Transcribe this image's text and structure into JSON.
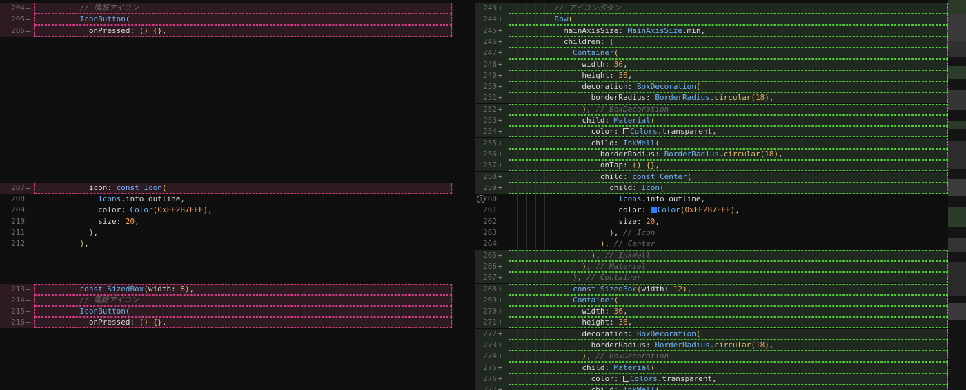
{
  "colors": {
    "removed_bg": "#2e1b21",
    "removed_border": "#d33a86",
    "added_bg": "#20291f",
    "added_border": "#4ed02c",
    "swatch_blue": "#2B7FFF"
  },
  "left_pane": {
    "lines": [
      {
        "num": "204",
        "mark": "—",
        "type": "del",
        "tokens": [
          [
            "cm",
            "// 情報アイコン"
          ]
        ]
      },
      {
        "num": "205",
        "mark": "—",
        "type": "del",
        "tokens": [
          [
            "t",
            "IconButton"
          ],
          [
            "f",
            "("
          ]
        ]
      },
      {
        "num": "206",
        "mark": "—",
        "type": "del",
        "tokens": [
          [
            "p",
            "  onPressed: "
          ],
          [
            "f",
            "() {}"
          ],
          [
            "p",
            ","
          ]
        ]
      },
      {
        "gap": 13
      },
      {
        "num": "207",
        "mark": "—",
        "type": "del",
        "tokens": [
          [
            "p",
            "  icon: "
          ],
          [
            "k",
            "const "
          ],
          [
            "t",
            "Icon"
          ],
          [
            "f",
            "("
          ]
        ]
      },
      {
        "num": "208",
        "tokens": [
          [
            "p",
            "    "
          ],
          [
            "t",
            "Icons"
          ],
          [
            "p",
            ".info_outline,"
          ]
        ]
      },
      {
        "num": "209",
        "tokens": [
          [
            "p",
            "    color: "
          ],
          [
            "t",
            "Color"
          ],
          [
            "f",
            "("
          ],
          [
            "n",
            "0xFF2B7FFF"
          ],
          [
            "f",
            ")"
          ],
          [
            "p",
            ","
          ]
        ]
      },
      {
        "num": "210",
        "tokens": [
          [
            "p",
            "    size: "
          ],
          [
            "n",
            "20"
          ],
          [
            "p",
            ","
          ]
        ]
      },
      {
        "num": "211",
        "tokens": [
          [
            "f",
            "  )"
          ],
          [
            "p",
            ","
          ]
        ]
      },
      {
        "num": "212",
        "tokens": [
          [
            "f",
            ")"
          ],
          [
            "p",
            ","
          ]
        ]
      },
      {
        "gap": 3
      },
      {
        "num": "213",
        "mark": "—",
        "type": "del",
        "tokens": [
          [
            "k",
            "const "
          ],
          [
            "t",
            "SizedBox"
          ],
          [
            "f",
            "("
          ],
          [
            "p",
            "width: "
          ],
          [
            "n",
            "8"
          ],
          [
            "f",
            ")"
          ],
          [
            "p",
            ","
          ]
        ]
      },
      {
        "num": "214",
        "mark": "—",
        "type": "del",
        "tokens": [
          [
            "cm",
            "// 電話アイコン"
          ]
        ]
      },
      {
        "num": "215",
        "mark": "—",
        "type": "del",
        "tokens": [
          [
            "t",
            "IconButton"
          ],
          [
            "f",
            "("
          ]
        ]
      },
      {
        "num": "216",
        "mark": "—",
        "type": "del",
        "tokens": [
          [
            "p",
            "  onPressed: "
          ],
          [
            "f",
            "() {}"
          ],
          [
            "p",
            ","
          ]
        ]
      }
    ]
  },
  "right_pane": {
    "lines": [
      {
        "num": "243",
        "mark": "+",
        "type": "ins",
        "tokens": [
          [
            "cm",
            "// アイコンボタン"
          ]
        ]
      },
      {
        "num": "244",
        "mark": "+",
        "type": "ins",
        "tokens": [
          [
            "t",
            "Row"
          ],
          [
            "f",
            "("
          ]
        ]
      },
      {
        "num": "245",
        "mark": "+",
        "type": "ins",
        "tokens": [
          [
            "p",
            "  mainAxisSize: "
          ],
          [
            "t",
            "MainAxisSize"
          ],
          [
            "p",
            ".min,"
          ]
        ]
      },
      {
        "num": "246",
        "mark": "+",
        "type": "ins",
        "tokens": [
          [
            "p",
            "  children: "
          ],
          [
            "f",
            "["
          ]
        ]
      },
      {
        "num": "247",
        "mark": "+",
        "type": "ins",
        "tokens": [
          [
            "p",
            "    "
          ],
          [
            "t",
            "Container"
          ],
          [
            "f",
            "("
          ]
        ]
      },
      {
        "num": "248",
        "mark": "+",
        "type": "ins",
        "tokens": [
          [
            "p",
            "      width: "
          ],
          [
            "n",
            "36"
          ],
          [
            "p",
            ","
          ]
        ]
      },
      {
        "num": "249",
        "mark": "+",
        "type": "ins",
        "tokens": [
          [
            "p",
            "      height: "
          ],
          [
            "n",
            "36"
          ],
          [
            "p",
            ","
          ]
        ]
      },
      {
        "num": "250",
        "mark": "+",
        "type": "ins",
        "tokens": [
          [
            "p",
            "      decoration: "
          ],
          [
            "t",
            "BoxDecoration"
          ],
          [
            "f",
            "("
          ]
        ]
      },
      {
        "num": "251",
        "mark": "+",
        "type": "ins",
        "tokens": [
          [
            "p",
            "        borderRadius: "
          ],
          [
            "t",
            "BorderRadius"
          ],
          [
            "p",
            "."
          ],
          [
            "f",
            "circular("
          ],
          [
            "n",
            "18"
          ],
          [
            "f",
            ")"
          ],
          [
            "p",
            ","
          ]
        ]
      },
      {
        "num": "252",
        "mark": "+",
        "type": "ins",
        "tokens": [
          [
            "f",
            "      )"
          ],
          [
            "p",
            ", "
          ],
          [
            "cm",
            "// BoxDecoration"
          ]
        ]
      },
      {
        "num": "253",
        "mark": "+",
        "type": "ins",
        "tokens": [
          [
            "p",
            "      child: "
          ],
          [
            "t",
            "Material"
          ],
          [
            "f",
            "("
          ]
        ]
      },
      {
        "num": "254",
        "mark": "+",
        "type": "ins",
        "tokens": [
          [
            "p",
            "        color: "
          ],
          [
            "swatch",
            "clear"
          ],
          [
            "t",
            "Colors"
          ],
          [
            "p",
            ".transparent,"
          ]
        ]
      },
      {
        "num": "255",
        "mark": "+",
        "type": "ins",
        "tokens": [
          [
            "p",
            "        child: "
          ],
          [
            "t",
            "InkWell"
          ],
          [
            "f",
            "("
          ]
        ]
      },
      {
        "num": "256",
        "mark": "+",
        "type": "ins",
        "tokens": [
          [
            "p",
            "          borderRadius: "
          ],
          [
            "t",
            "BorderRadius"
          ],
          [
            "p",
            "."
          ],
          [
            "f",
            "circular("
          ],
          [
            "n",
            "18"
          ],
          [
            "f",
            ")"
          ],
          [
            "p",
            ","
          ]
        ]
      },
      {
        "num": "257",
        "mark": "+",
        "type": "ins",
        "tokens": [
          [
            "p",
            "          onTap: "
          ],
          [
            "f",
            "() {}"
          ],
          [
            "p",
            ","
          ]
        ]
      },
      {
        "num": "258",
        "mark": "+",
        "type": "ins",
        "tokens": [
          [
            "p",
            "          child: "
          ],
          [
            "k",
            "const "
          ],
          [
            "t",
            "Center"
          ],
          [
            "f",
            "("
          ]
        ]
      },
      {
        "num": "259",
        "mark": "+",
        "type": "ins",
        "tokens": [
          [
            "p",
            "            child: "
          ],
          [
            "t",
            "Icon"
          ],
          [
            "f",
            "("
          ]
        ]
      },
      {
        "num": "260",
        "info": true,
        "tokens": [
          [
            "p",
            "              "
          ],
          [
            "t",
            "Icons"
          ],
          [
            "p",
            ".info_outline,"
          ]
        ]
      },
      {
        "num": "261",
        "tokens": [
          [
            "p",
            "              color: "
          ],
          [
            "swatch",
            "blue"
          ],
          [
            "t",
            "Color"
          ],
          [
            "f",
            "("
          ],
          [
            "n",
            "0xFF2B7FFF"
          ],
          [
            "f",
            ")"
          ],
          [
            "p",
            ","
          ]
        ]
      },
      {
        "num": "262",
        "tokens": [
          [
            "p",
            "              size: "
          ],
          [
            "n",
            "20"
          ],
          [
            "p",
            ","
          ]
        ]
      },
      {
        "num": "263",
        "tokens": [
          [
            "f",
            "            )"
          ],
          [
            "p",
            ", "
          ],
          [
            "cm",
            "// Icon"
          ]
        ]
      },
      {
        "num": "264",
        "tokens": [
          [
            "f",
            "          )"
          ],
          [
            "p",
            ", "
          ],
          [
            "cm",
            "// Center"
          ]
        ]
      },
      {
        "num": "265",
        "mark": "+",
        "type": "ins",
        "tokens": [
          [
            "f",
            "        )"
          ],
          [
            "p",
            ", "
          ],
          [
            "cm",
            "// InkWell"
          ]
        ]
      },
      {
        "num": "266",
        "mark": "+",
        "type": "ins",
        "tokens": [
          [
            "f",
            "      )"
          ],
          [
            "p",
            ", "
          ],
          [
            "cm",
            "// Material"
          ]
        ]
      },
      {
        "num": "267",
        "mark": "+",
        "type": "ins",
        "tokens": [
          [
            "f",
            "    )"
          ],
          [
            "p",
            ", "
          ],
          [
            "cm",
            "// Container"
          ]
        ]
      },
      {
        "num": "268",
        "mark": "+",
        "type": "ins",
        "tokens": [
          [
            "p",
            "    "
          ],
          [
            "k",
            "const "
          ],
          [
            "t",
            "SizedBox"
          ],
          [
            "f",
            "("
          ],
          [
            "p",
            "width: "
          ],
          [
            "n",
            "12"
          ],
          [
            "f",
            ")"
          ],
          [
            "p",
            ","
          ]
        ]
      },
      {
        "num": "269",
        "mark": "+",
        "type": "ins",
        "tokens": [
          [
            "p",
            "    "
          ],
          [
            "t",
            "Container"
          ],
          [
            "f",
            "("
          ]
        ]
      },
      {
        "num": "270",
        "mark": "+",
        "type": "ins",
        "tokens": [
          [
            "p",
            "      width: "
          ],
          [
            "n",
            "36"
          ],
          [
            "p",
            ","
          ]
        ]
      },
      {
        "num": "271",
        "mark": "+",
        "type": "ins",
        "tokens": [
          [
            "p",
            "      height: "
          ],
          [
            "n",
            "36"
          ],
          [
            "p",
            ","
          ]
        ]
      },
      {
        "num": "272",
        "mark": "+",
        "type": "ins",
        "tokens": [
          [
            "p",
            "      decoration: "
          ],
          [
            "t",
            "BoxDecoration"
          ],
          [
            "f",
            "("
          ]
        ]
      },
      {
        "num": "273",
        "mark": "+",
        "type": "ins",
        "tokens": [
          [
            "p",
            "        borderRadius: "
          ],
          [
            "t",
            "BorderRadius"
          ],
          [
            "p",
            "."
          ],
          [
            "f",
            "circular("
          ],
          [
            "n",
            "18"
          ],
          [
            "f",
            ")"
          ],
          [
            "p",
            ","
          ]
        ]
      },
      {
        "num": "274",
        "mark": "+",
        "type": "ins",
        "tokens": [
          [
            "f",
            "      )"
          ],
          [
            "p",
            ", "
          ],
          [
            "cm",
            "// BoxDecoration"
          ]
        ]
      },
      {
        "num": "275",
        "mark": "+",
        "type": "ins",
        "tokens": [
          [
            "p",
            "      child: "
          ],
          [
            "t",
            "Material"
          ],
          [
            "f",
            "("
          ]
        ]
      },
      {
        "num": "276",
        "mark": "+",
        "type": "ins",
        "tokens": [
          [
            "p",
            "        color: "
          ],
          [
            "swatch",
            "clear"
          ],
          [
            "t",
            "Colors"
          ],
          [
            "p",
            ".transparent,"
          ]
        ]
      },
      {
        "num": "277",
        "mark": "+",
        "type": "ins",
        "tokens": [
          [
            "p",
            "        child: "
          ],
          [
            "t",
            "InkWell"
          ],
          [
            "f",
            "("
          ]
        ]
      }
    ]
  }
}
